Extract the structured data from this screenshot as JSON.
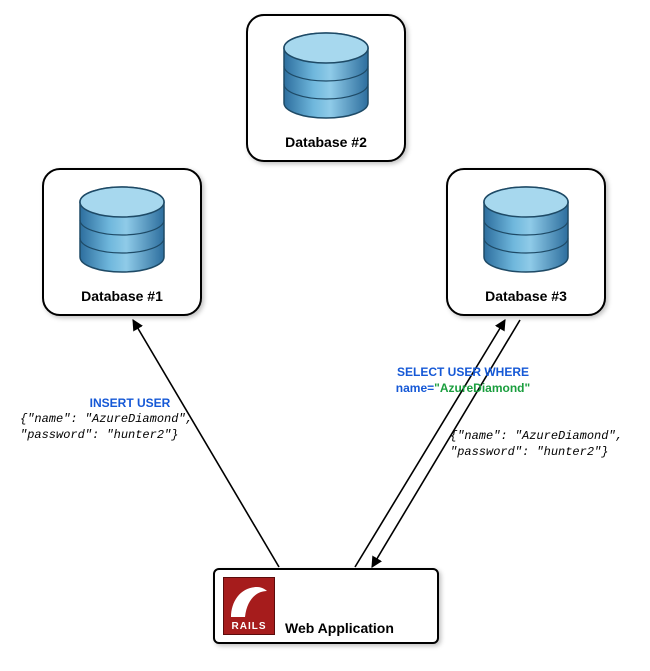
{
  "nodes": {
    "db1": {
      "label": "Database #1"
    },
    "db2": {
      "label": "Database #2"
    },
    "db3": {
      "label": "Database #3"
    },
    "app": {
      "label": "Web Application",
      "logo_text": "RAILS"
    }
  },
  "annotations": {
    "insert": {
      "header": "INSERT USER",
      "body": "{\"name\": \"AzureDiamond\",\n\"password\": \"hunter2\"}"
    },
    "select": {
      "header": "SELECT USER WHERE",
      "field": "name=",
      "value": "\"AzureDiamond\""
    },
    "result": {
      "body": "{\"name\": \"AzureDiamond\",\n\"password\": \"hunter2\"}"
    }
  },
  "edges": [
    {
      "from": "app",
      "to": "db1",
      "type": "one-way"
    },
    {
      "from": "app",
      "to": "db3",
      "type": "two-way"
    }
  ]
}
